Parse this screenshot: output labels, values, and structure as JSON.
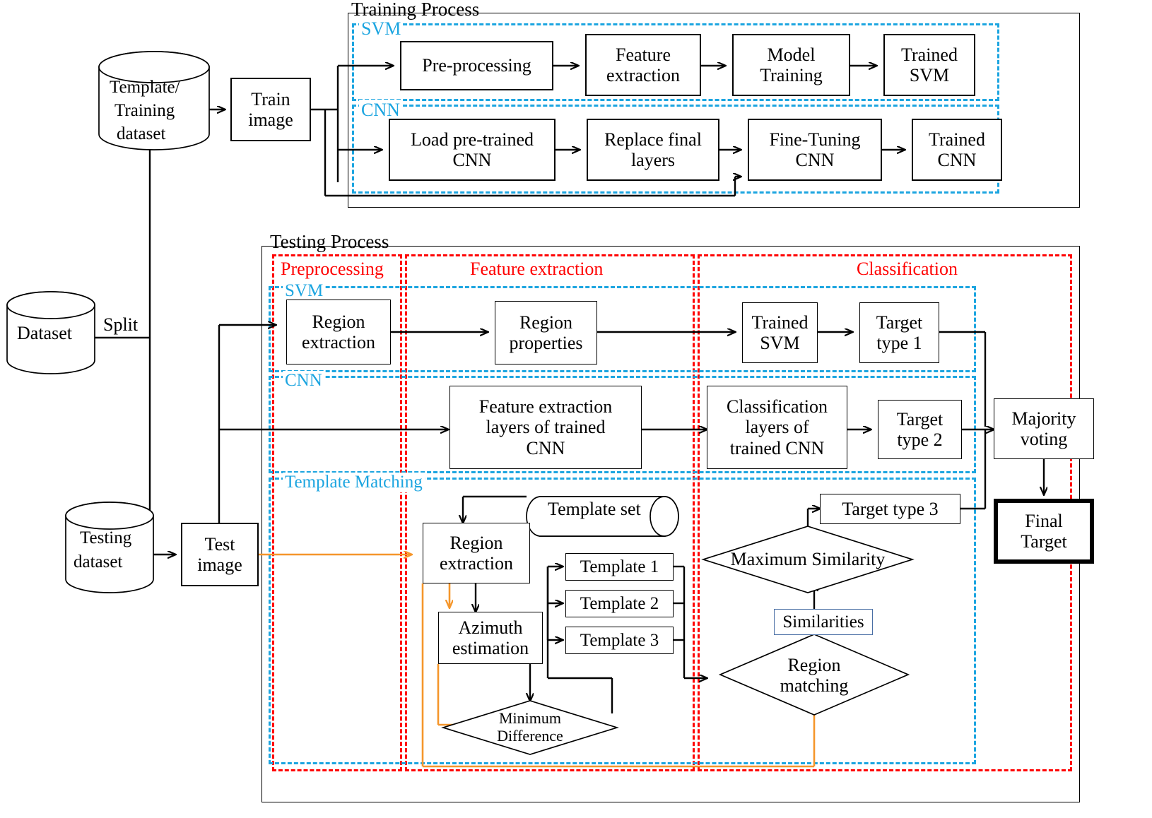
{
  "diagram": {
    "title_training": "Training Process",
    "title_testing": "Testing Process",
    "colors": {
      "cyan": "#1CA5E0",
      "red": "#FF0000",
      "orange": "#F5962B",
      "black": "#000000"
    }
  },
  "datasets": {
    "template_training": "Template/\nTraining\ndataset",
    "template_training_l1": "Template/",
    "template_training_l2": "Training",
    "template_training_l3": "dataset",
    "dataset": "Dataset",
    "split_label": "Split",
    "testing_dataset_l1": "Testing",
    "testing_dataset_l2": "dataset",
    "template_set": "Template set"
  },
  "training": {
    "section_title": "Training Process",
    "train_image_l1": "Train",
    "train_image_l2": "image",
    "svm_group_label": "SVM",
    "cnn_group_label": "CNN",
    "svm_steps": [
      {
        "l1": "Pre-processing",
        "l2": ""
      },
      {
        "l1": "Feature",
        "l2": "extraction"
      },
      {
        "l1": "Model",
        "l2": "Training"
      },
      {
        "l1": "Trained",
        "l2": "SVM"
      }
    ],
    "cnn_steps": [
      {
        "l1": "Load pre-trained",
        "l2": "CNN"
      },
      {
        "l1": "Replace final",
        "l2": "layers"
      },
      {
        "l1": "Fine-Tuning",
        "l2": "CNN"
      },
      {
        "l1": "Trained",
        "l2": "CNN"
      }
    ]
  },
  "testing": {
    "section_title": "Testing Process",
    "test_image_l1": "Test",
    "test_image_l2": "image",
    "stage_preprocessing": "Preprocessing",
    "stage_feature_extraction": "Feature extraction",
    "stage_classification": "Classification",
    "group_svm": "SVM",
    "group_cnn": "CNN",
    "group_template_matching": "Template Matching",
    "svm_row": {
      "region_extraction_l1": "Region",
      "region_extraction_l2": "extraction",
      "region_properties_l1": "Region",
      "region_properties_l2": "properties",
      "trained_svm_l1": "Trained",
      "trained_svm_l2": "SVM",
      "target_type_1_l1": "Target",
      "target_type_1_l2": "type 1"
    },
    "cnn_row": {
      "feature_layers_l1": "Feature extraction",
      "feature_layers_l2": "layers of trained",
      "feature_layers_l3": "CNN",
      "classification_layers_l1": "Classification",
      "classification_layers_l2": "layers of",
      "classification_layers_l3": "trained CNN",
      "target_type_2_l1": "Target",
      "target_type_2_l2": "type 2"
    },
    "template_row": {
      "region_extraction_l1": "Region",
      "region_extraction_l2": "extraction",
      "azimuth_l1": "Azimuth",
      "azimuth_l2": "estimation",
      "templates": [
        "Template 1",
        "Template 2",
        "Template 3"
      ],
      "minimum_difference_l1": "Minimum",
      "minimum_difference_l2": "Difference",
      "region_matching_l1": "Region",
      "region_matching_l2": "matching",
      "similarities": "Similarities",
      "maximum_similarity": "Maximum Similarity",
      "target_type_3": "Target type 3"
    },
    "majority_voting_l1": "Majority",
    "majority_voting_l2": "voting",
    "final_target_l1": "Final",
    "final_target_l2": "Target"
  }
}
